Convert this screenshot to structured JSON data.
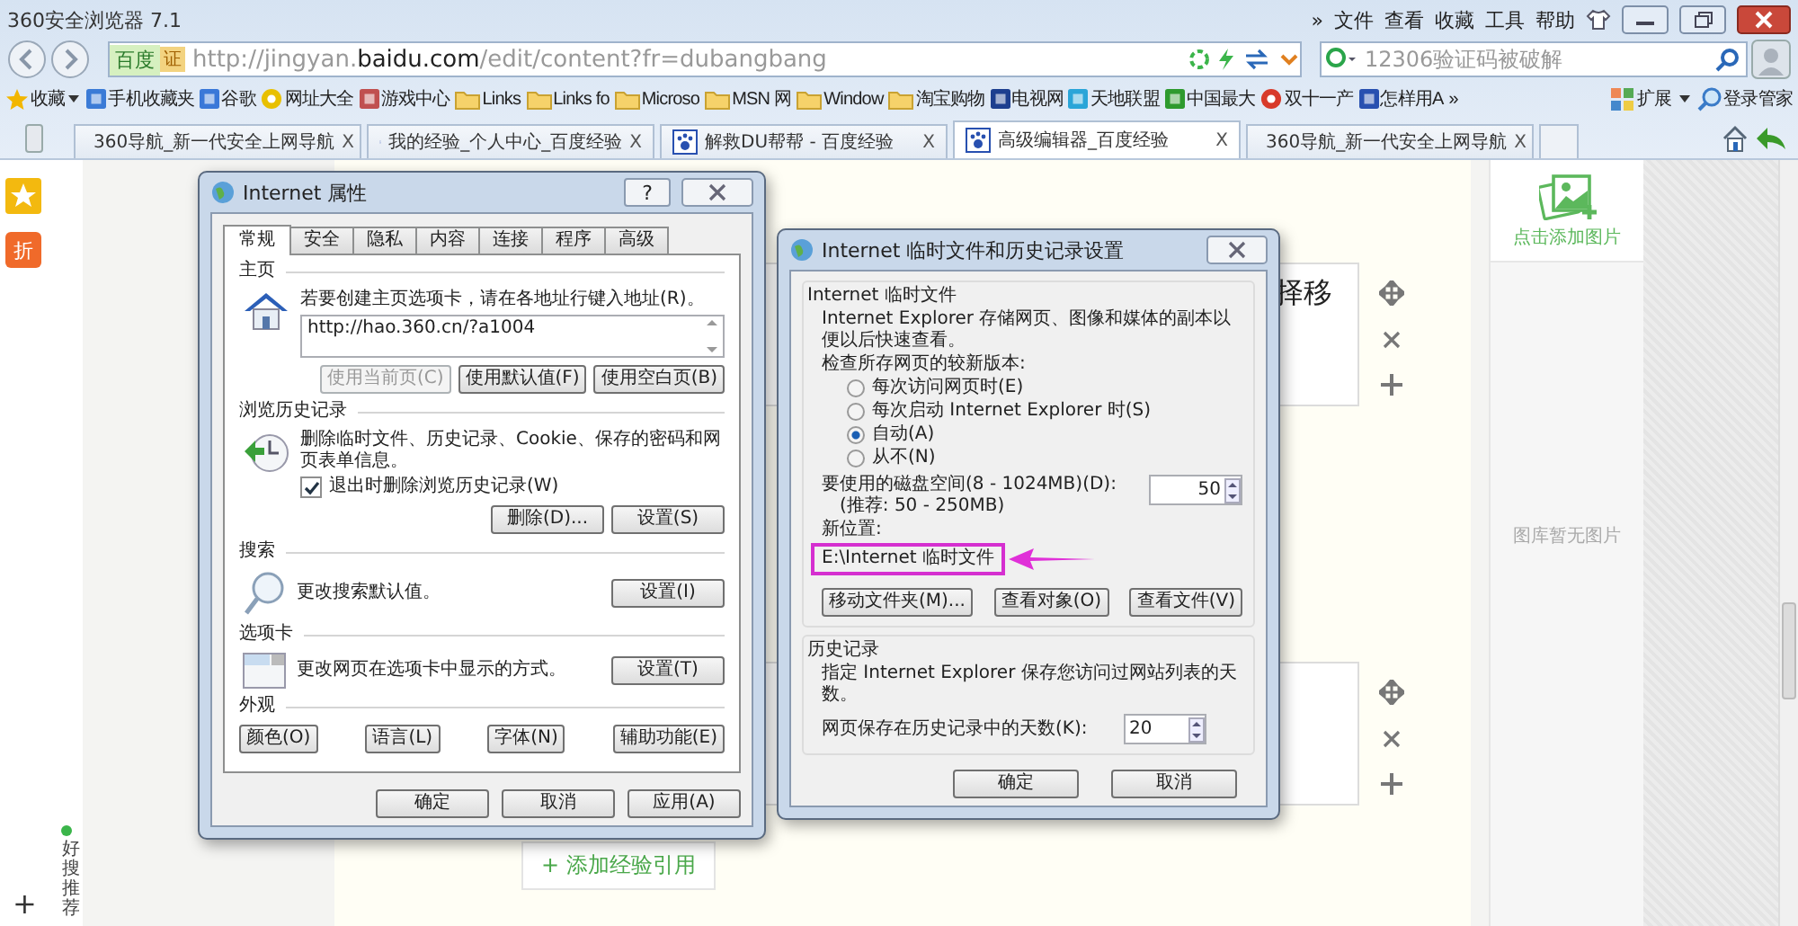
{
  "browser": {
    "title": "360安全浏览器 7.1",
    "menu": [
      "»",
      "文件",
      "查看",
      "收藏",
      "工具",
      "帮助"
    ],
    "address": {
      "badge": "百度",
      "cert": "证",
      "url": "http://jingyan.**baidu.com**/edit/content?fr=dubangbang"
    },
    "search": {
      "placeholder": "12306验证码被破解"
    },
    "bookmarks": [
      {
        "label": "收藏",
        "kind": "star"
      },
      {
        "label": "手机收藏夹",
        "kind": "square",
        "color": "#3b7bd6"
      },
      {
        "label": "谷歌",
        "kind": "square",
        "color": "#3a78d8"
      },
      {
        "label": "网址大全",
        "kind": "circle",
        "color": "#e8c000"
      },
      {
        "label": "游戏中心",
        "kind": "square",
        "color": "#c05050"
      },
      {
        "label": "Links",
        "kind": "folder"
      },
      {
        "label": "Links fo",
        "kind": "folder"
      },
      {
        "label": "Microso",
        "kind": "folder"
      },
      {
        "label": "MSN 网",
        "kind": "folder"
      },
      {
        "label": "Window",
        "kind": "folder"
      },
      {
        "label": "淘宝购物",
        "kind": "folder"
      },
      {
        "label": "电视网",
        "kind": "square",
        "color": "#1d3f8f"
      },
      {
        "label": "天地联盟",
        "kind": "square",
        "color": "#2aa5d8"
      },
      {
        "label": "中国最大",
        "kind": "square",
        "color": "#2e9a2e"
      },
      {
        "label": "双十一产",
        "kind": "circle",
        "color": "#d83a2a"
      },
      {
        "label": "怎样用A",
        "kind": "square",
        "color": "#2850b0"
      }
    ],
    "bookmarks_more": "»",
    "extensions": "扩展",
    "login": "登录管家",
    "tabs": [
      {
        "label": "360导航_新一代安全上网导航",
        "kind": "nav",
        "selected": false,
        "close": "X"
      },
      {
        "label": "我的经验_个人中心_百度经验",
        "kind": "baidu",
        "selected": false,
        "close": "X"
      },
      {
        "label": "解救DU帮帮 - 百度经验",
        "kind": "baidu",
        "selected": false,
        "close": "X"
      },
      {
        "label": "高级编辑器_百度经验",
        "kind": "baidu",
        "selected": true,
        "close": "X"
      },
      {
        "label": "360导航_新一代安全上网导航",
        "kind": "nav",
        "selected": false,
        "close": "X"
      }
    ]
  },
  "page": {
    "side_badge": "折",
    "editor_boxes": [
      {
        "kind": "text",
        "text": "择移"
      },
      {
        "kind": "empty"
      }
    ],
    "add_reference": "+ 添加经验引用",
    "add_image": "点击添加图片",
    "gallery_empty": "图库暂无图片",
    "recommend": "好搜推荐",
    "recommend_add": "+"
  },
  "properties": {
    "title": "Internet 属性",
    "help": "?",
    "tabs": [
      {
        "label": "常规",
        "selected": true
      },
      {
        "label": "安全",
        "selected": false
      },
      {
        "label": "隐私",
        "selected": false
      },
      {
        "label": "内容",
        "selected": false
      },
      {
        "label": "连接",
        "selected": false
      },
      {
        "label": "程序",
        "selected": false
      },
      {
        "label": "高级",
        "selected": false
      }
    ],
    "home": {
      "heading": "主页",
      "text": "若要创建主页选项卡，请在各地址行键入地址(R)。",
      "value": "http://hao.360.cn/?a1004",
      "buttons": [
        {
          "label": "使用当前页(C)",
          "disabled": true
        },
        {
          "label": "使用默认值(F)",
          "disabled": false
        },
        {
          "label": "使用空白页(B)",
          "disabled": false
        }
      ]
    },
    "history": {
      "heading": "浏览历史记录",
      "text": "删除临时文件、历史记录、Cookie、保存的密码和网页表单信息。",
      "checkbox": {
        "label": "退出时删除浏览历史记录(W)",
        "checked": true
      },
      "buttons": [
        "删除(D)...",
        "设置(S)"
      ]
    },
    "search": {
      "heading": "搜索",
      "text": "更改搜索默认值。",
      "button": "设置(I)"
    },
    "tabs_section": {
      "heading": "选项卡",
      "text": "更改网页在选项卡中显示的方式。",
      "button": "设置(T)"
    },
    "appearance": {
      "heading": "外观",
      "buttons": [
        "颜色(O)",
        "语言(L)",
        "字体(N)",
        "辅助功能(E)"
      ]
    },
    "footer": [
      "确定",
      "取消",
      "应用(A)"
    ]
  },
  "cache": {
    "title": "Internet 临时文件和历史记录设置",
    "temp": {
      "heading": "Internet 临时文件",
      "text": "Internet Explorer 存储网页、图像和媒体的副本以便以后快速查看。",
      "check_label": "检查所存网页的较新版本:",
      "check_options": [
        {
          "label": "每次访问网页时(E)",
          "selected": false
        },
        {
          "label": "每次启动 Internet Explorer 时(S)",
          "selected": false
        },
        {
          "label": "自动(A)",
          "selected": true
        },
        {
          "label": "从不(N)",
          "selected": false
        }
      ],
      "space_label": "要使用的磁盘空间(8 - 1024MB)(D):",
      "space_hint": "(推荐: 50 - 250MB)",
      "space_value": "50",
      "location_label": "新位置:",
      "location": "E:\\Internet 临时文件",
      "buttons": [
        "移动文件夹(M)...",
        "查看对象(O)",
        "查看文件(V)"
      ]
    },
    "history": {
      "heading": "历史记录",
      "text": "指定 Internet Explorer 保存您访问过网站列表的天数。",
      "days_label": "网页保存在历史记录中的天数(K):",
      "days_value": "20"
    },
    "footer": [
      "确定",
      "取消"
    ]
  }
}
